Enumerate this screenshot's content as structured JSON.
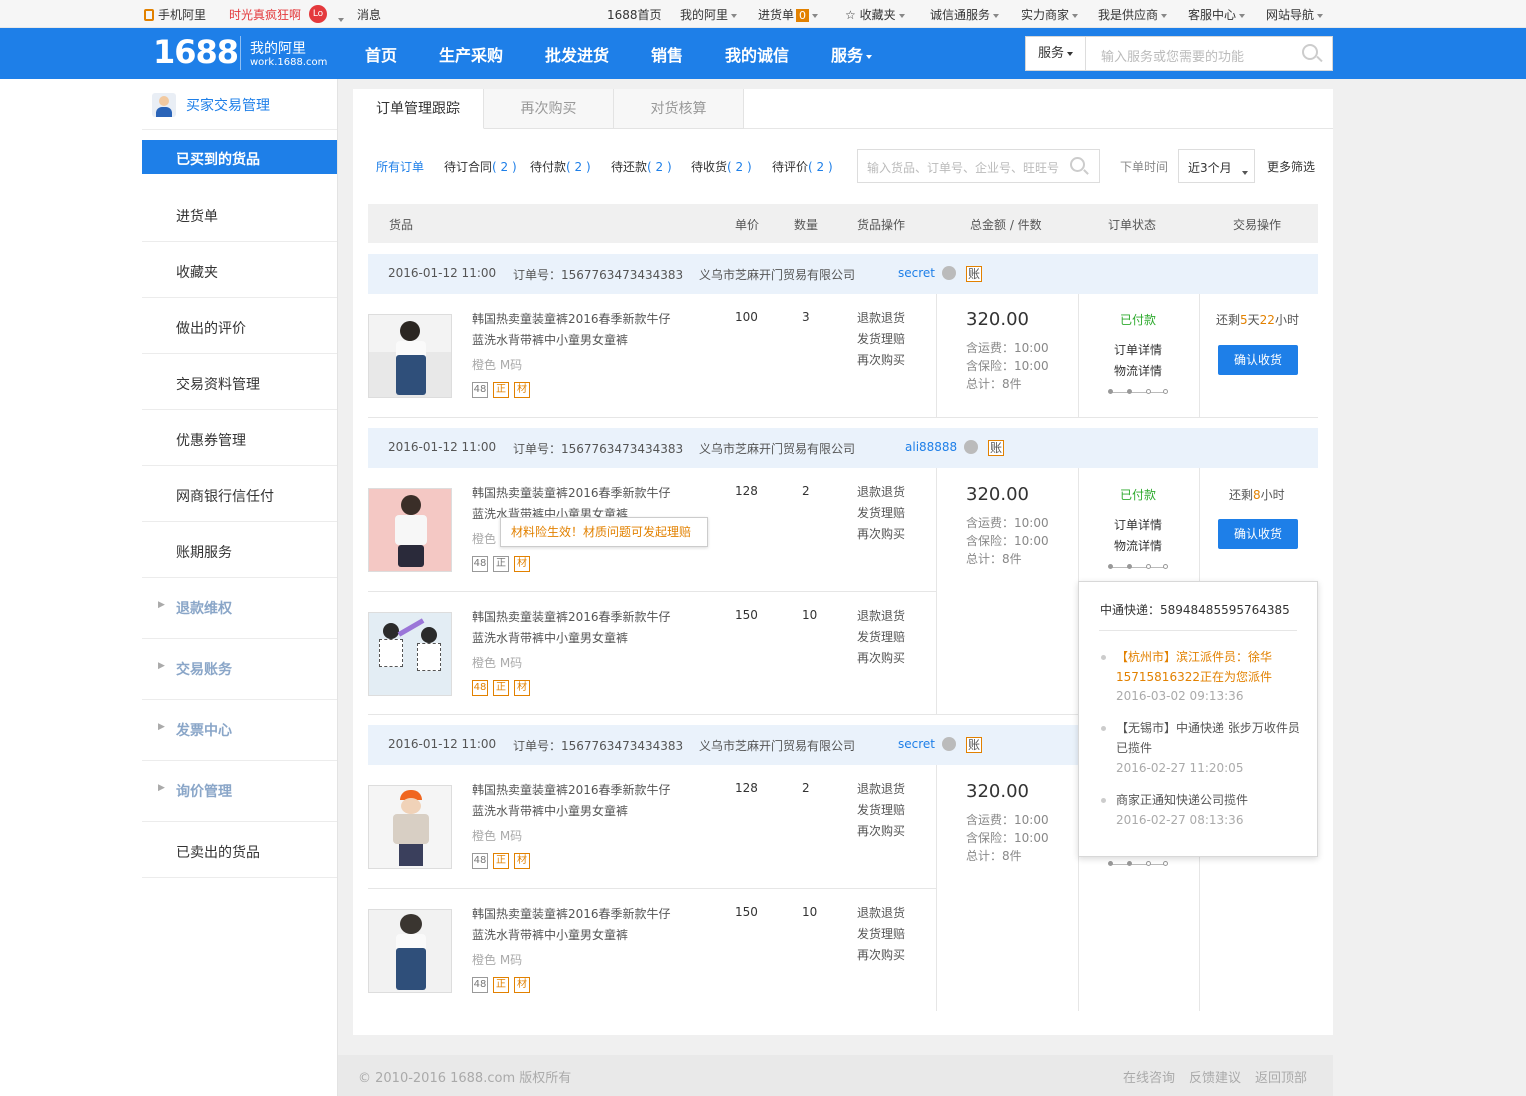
{
  "topbar": {
    "mobile": "手机阿里",
    "promo": "时光真疯狂啊",
    "promo_badge": "Lo",
    "messages": "消息",
    "home": "1688首页",
    "my_ali": "我的阿里",
    "purchase": "进货单",
    "purchase_count": "0",
    "favorites": "收藏夹",
    "chengxintong": "诚信通服务",
    "merchants": "实力商家",
    "supplier": "我是供应商",
    "service_center": "客服中心",
    "site_nav": "网站导航"
  },
  "header": {
    "logo": "1688",
    "my_ali": "我的阿里",
    "site": "work.1688.com",
    "nav": [
      "首页",
      "生产采购",
      "批发进货",
      "销售",
      "我的诚信",
      "服务"
    ],
    "search_category": "服务",
    "search_placeholder": "输入服务或您需要的功能"
  },
  "sidebar": {
    "title": "买家交易管理",
    "items": [
      "已买到的货品",
      "进货单",
      "收藏夹",
      "做出的评价",
      "交易资料管理",
      "优惠券管理",
      "网商银行信任付",
      "账期服务"
    ],
    "groups": [
      "退款维权",
      "交易账务",
      "发票中心",
      "询价管理"
    ],
    "last": "已卖出的货品"
  },
  "tabs": [
    "订单管理跟踪",
    "再次购买",
    "对货核算"
  ],
  "filters": {
    "all": "所有订单",
    "items": [
      {
        "label": "待订合同",
        "count": "( 2 )"
      },
      {
        "label": "待付款",
        "count": "( 2 )"
      },
      {
        "label": "待还款",
        "count": "( 2 )"
      },
      {
        "label": "待收货",
        "count": "( 2 )"
      },
      {
        "label": "待评价",
        "count": "( 2 )"
      }
    ],
    "search_placeholder": "输入货品、订单号、企业号、旺旺号",
    "time_label": "下单时间",
    "time_value": "近3个月",
    "more": "更多筛选"
  },
  "columns": [
    "货品",
    "单价",
    "数量",
    "货品操作",
    "总金额 / 件数",
    "订单状态",
    "交易操作"
  ],
  "common": {
    "product_name_1": "韩国热卖童装童裤2016春季新款牛仔",
    "product_name_2": "蓝洗水背带裤中小童男女童裤",
    "spec": "橙色   M码",
    "tags": [
      "48",
      "正",
      "材"
    ],
    "ops": [
      "退款退货",
      "发货理赔",
      "再次购买"
    ],
    "price": "320.00",
    "shipping": "含运费：10:00",
    "insurance": "含保险：10:00",
    "total": "总计：8件",
    "status": "已付款",
    "detail": "订单详情",
    "logistics": "物流详情",
    "confirm": "确认收货",
    "ledger": "账"
  },
  "orders": [
    {
      "date": "2016-01-12 11:00",
      "order_no": "订单号：1567763473434383",
      "company": "义乌市芝麻开门贸易有限公司",
      "buyer": "secret",
      "remain_prefix": "还剩",
      "remain_days": "5",
      "remain_day_unit": "天",
      "remain_hours": "22",
      "remain_hour_unit": "小时",
      "items": [
        {
          "unit": "100",
          "qty": "3"
        }
      ]
    },
    {
      "date": "2016-01-12 11:00",
      "order_no": "订单号：1567763473434383",
      "company": "义乌市芝麻开门贸易有限公司",
      "buyer": "ali88888",
      "remain_prefix": "还剩",
      "remain_hours": "8",
      "remain_hour_unit": "小时",
      "items": [
        {
          "unit": "128",
          "qty": "2"
        },
        {
          "unit": "150",
          "qty": "10"
        }
      ]
    },
    {
      "date": "2016-01-12 11:00",
      "order_no": "订单号：1567763473434383",
      "company": "义乌市芝麻开门贸易有限公司",
      "buyer": "secret",
      "items": [
        {
          "unit": "128",
          "qty": "2"
        },
        {
          "unit": "150",
          "qty": "10"
        }
      ]
    }
  ],
  "tooltip": "材料险生效！材质问题可发起理赔",
  "logistics_popup": {
    "carrier": "中通快递：58948485595764385",
    "events": [
      {
        "text": "【杭州市】滨江派件员：徐华15715816322正在为您派件",
        "time": "2016-03-02 09:13:36"
      },
      {
        "text": "【无锡市】中通快递 张步万收件员 已揽件",
        "time": "2016-02-27 11:20:05"
      },
      {
        "text": "商家正通知快递公司揽件",
        "time": "2016-02-27 08:13:36"
      }
    ]
  },
  "footer": {
    "copyright": "© 2010-2016 1688.com 版权所有",
    "links": [
      "在线咨询",
      "反馈建议",
      "返回顶部"
    ]
  },
  "colors": {
    "brand": "#1e7fe8",
    "accent": "#e28100",
    "paid": "#2eaa2e"
  }
}
